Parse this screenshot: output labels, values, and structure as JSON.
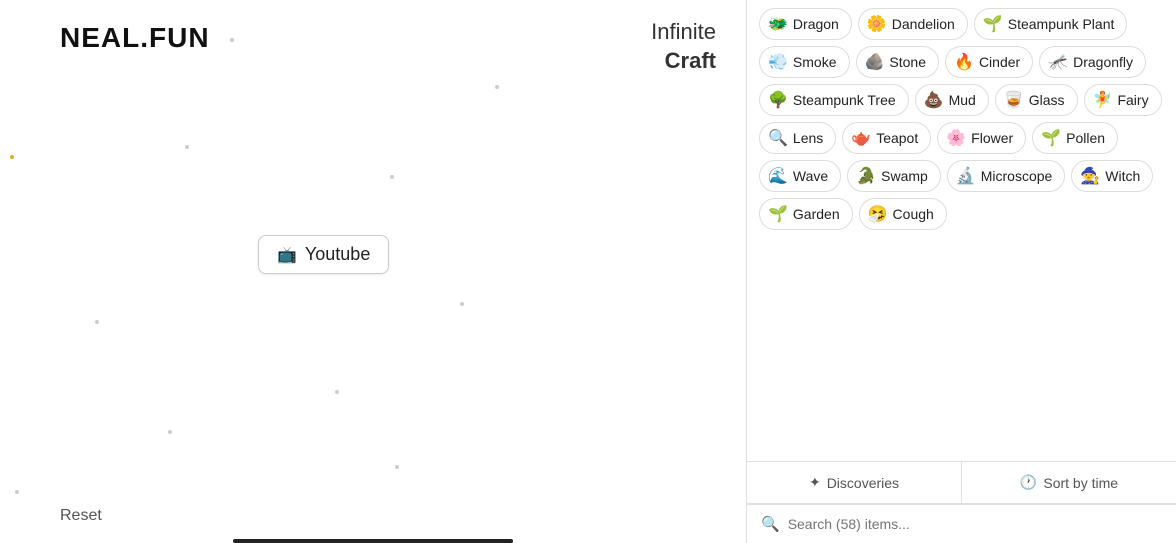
{
  "logo": {
    "neal_fun": "NEAL.FUN",
    "infinite": "Infinite",
    "craft": "Craft"
  },
  "canvas": {
    "youtube_label": "Youtube",
    "youtube_emoji": "📺",
    "reset_label": "Reset"
  },
  "elements": [
    {
      "emoji": "🐲",
      "label": "Dragon"
    },
    {
      "emoji": "🌼",
      "label": "Dandelion"
    },
    {
      "emoji": "🌱",
      "label": "Steampunk Plant"
    },
    {
      "emoji": "💨",
      "label": "Smoke"
    },
    {
      "emoji": "🪨",
      "label": "Stone"
    },
    {
      "emoji": "🔥",
      "label": "Cinder"
    },
    {
      "emoji": "🦟",
      "label": "Dragonfly"
    },
    {
      "emoji": "🌳",
      "label": "Steampunk Tree"
    },
    {
      "emoji": "💩",
      "label": "Mud"
    },
    {
      "emoji": "🥃",
      "label": "Glass"
    },
    {
      "emoji": "🧚",
      "label": "Fairy"
    },
    {
      "emoji": "🔍",
      "label": "Lens"
    },
    {
      "emoji": "🫖",
      "label": "Teapot"
    },
    {
      "emoji": "🌸",
      "label": "Flower"
    },
    {
      "emoji": "🌱",
      "label": "Pollen"
    },
    {
      "emoji": "🌊",
      "label": "Wave"
    },
    {
      "emoji": "🐊",
      "label": "Swamp"
    },
    {
      "emoji": "🔬",
      "label": "Microscope"
    },
    {
      "emoji": "🧙",
      "label": "Witch"
    },
    {
      "emoji": "🌱",
      "label": "Garden"
    },
    {
      "emoji": "🤧",
      "label": "Cough"
    }
  ],
  "tabs": {
    "discoveries_label": "✦ Discoveries",
    "sort_label": "Sort by time"
  },
  "search": {
    "placeholder": "Search (58) items..."
  }
}
